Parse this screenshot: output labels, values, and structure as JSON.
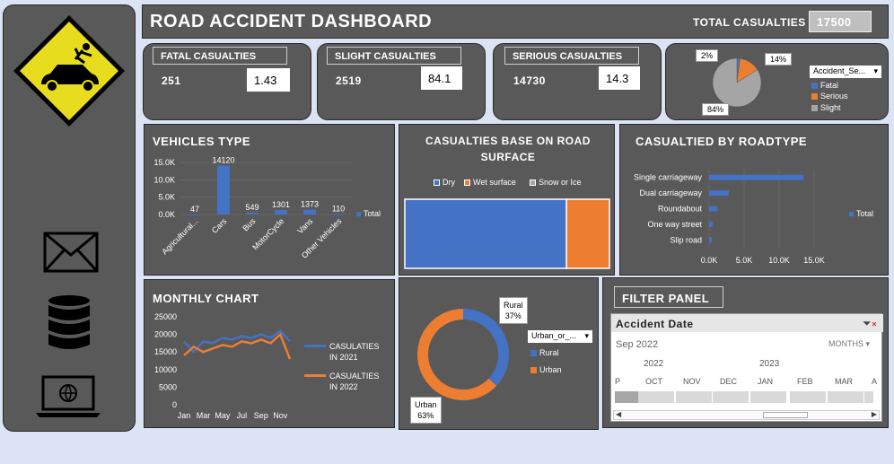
{
  "header": {
    "title": "ROAD ACCIDENT DASHBOARD",
    "total_label": "TOTAL CASUALTIES",
    "total_value": "17500"
  },
  "kpis": [
    {
      "label": "FATAL CASUALTIES",
      "count": "251",
      "pct": "1.43"
    },
    {
      "label": "SLIGHT CASUALTIES",
      "count": "2519",
      "pct": "84.1"
    },
    {
      "label": "SERIOUS CASUALTIES",
      "count": "14730",
      "pct": "14.3"
    }
  ],
  "severity_pie": {
    "labels": [
      "2%",
      "14%",
      "84%"
    ],
    "filter": "Accident_Se...",
    "legend": [
      "Fatal",
      "Serious",
      "Slight"
    ]
  },
  "sidebar": {
    "icons": [
      "warning-accident-icon",
      "mail-icon",
      "database-icon",
      "laptop-globe-icon"
    ]
  },
  "vehicles": {
    "title": "VEHICLES TYPE",
    "legend": "Total"
  },
  "surface": {
    "title": "CASUALTIES BASE ON ROAD SURFACE",
    "legend": [
      "Dry",
      "Wet surface",
      "Snow or Ice"
    ]
  },
  "roadtype": {
    "title": "CASUALTIED BY ROADTYPE",
    "legend": "Total"
  },
  "monthly": {
    "title": "MONTHLY CHART",
    "legend": [
      "CASULATIES IN 2021",
      "CASUALTIES IN 2022"
    ]
  },
  "urban": {
    "filter": "Urban_or_...",
    "legend": [
      "Rural",
      "Urban"
    ],
    "rural_label": "Rural",
    "rural_pct": "37%",
    "urban_label": "Urban",
    "urban_pct": "63%"
  },
  "filter_panel": {
    "title": "FILTER PANEL",
    "field": "Accident Date",
    "period": "Sep 2022",
    "months_label": "MONTHS",
    "year1": "2022",
    "year2": "2023",
    "months": [
      "P",
      "OCT",
      "NOV",
      "DEC",
      "JAN",
      "FEB",
      "MAR",
      "A"
    ]
  },
  "colors": {
    "panel": "#595959",
    "blue": "#4472c4",
    "orange": "#ed7d31",
    "gray": "#a5a5a5",
    "page": "#dbe3f4",
    "warning": "#e8dc1e"
  },
  "chart_data": [
    {
      "type": "bar",
      "name": "vehicles",
      "categories": [
        "Agricultural...",
        "Cars",
        "Bus",
        "MotorCycle",
        "Vans",
        "Other Vehicles"
      ],
      "values": [
        47,
        14120,
        549,
        1301,
        1373,
        110
      ],
      "series": [
        {
          "name": "Total",
          "values": [
            47,
            14120,
            549,
            1301,
            1373,
            110
          ]
        }
      ],
      "yticks": [
        "0.0K",
        "5.0K",
        "10.0K",
        "15.0K"
      ],
      "ylim": [
        0,
        15000
      ],
      "title": "VEHICLES TYPE"
    },
    {
      "type": "bar",
      "name": "road_surface",
      "orientation": "stacked-horizontal",
      "categories": [
        "Dry",
        "Wet surface",
        "Snow or Ice"
      ],
      "values": [
        0.79,
        0.21,
        0
      ],
      "title": "CASUALTIES BASE ON ROAD SURFACE"
    },
    {
      "type": "bar",
      "name": "roadtype",
      "orientation": "horizontal",
      "categories": [
        "Single carriageway",
        "Dual carriageway",
        "Roundabout",
        "One way street",
        "Slip road"
      ],
      "values": [
        13500,
        2800,
        1200,
        500,
        400
      ],
      "xticks": [
        "0.0K",
        "5.0K",
        "10.0K",
        "15.0K"
      ],
      "xlim": [
        0,
        15000
      ],
      "series": [
        {
          "name": "Total",
          "values": [
            13500,
            2800,
            1200,
            500,
            400
          ]
        }
      ],
      "title": "CASUALTIED BY ROADTYPE"
    },
    {
      "type": "line",
      "name": "monthly",
      "x": [
        "Jan",
        "Feb",
        "Mar",
        "Apr",
        "May",
        "Jun",
        "Jul",
        "Aug",
        "Sep",
        "Oct",
        "Nov",
        "Dec"
      ],
      "xticks": [
        "Jan",
        "Mar",
        "May",
        "Jul",
        "Sep",
        "Nov"
      ],
      "yticks": [
        "0",
        "5000",
        "10000",
        "15000",
        "20000",
        "25000"
      ],
      "ylim": [
        0,
        25000
      ],
      "series": [
        {
          "name": "CASULATIES IN 2021",
          "values": [
            18000,
            15000,
            18000,
            17500,
            19000,
            18500,
            19500,
            19000,
            20000,
            19000,
            21000,
            18000
          ]
        },
        {
          "name": "CASUALTIES IN 2022",
          "values": [
            14000,
            16500,
            15000,
            16000,
            17000,
            16500,
            18000,
            17500,
            18500,
            17500,
            20000,
            13000
          ]
        }
      ],
      "title": "MONTHLY CHART"
    },
    {
      "type": "pie",
      "name": "urban_rural",
      "donut": true,
      "categories": [
        "Rural",
        "Urban"
      ],
      "values": [
        37,
        63
      ]
    },
    {
      "type": "pie",
      "name": "severity",
      "categories": [
        "Fatal",
        "Serious",
        "Slight"
      ],
      "values": [
        2,
        14,
        84
      ]
    }
  ]
}
